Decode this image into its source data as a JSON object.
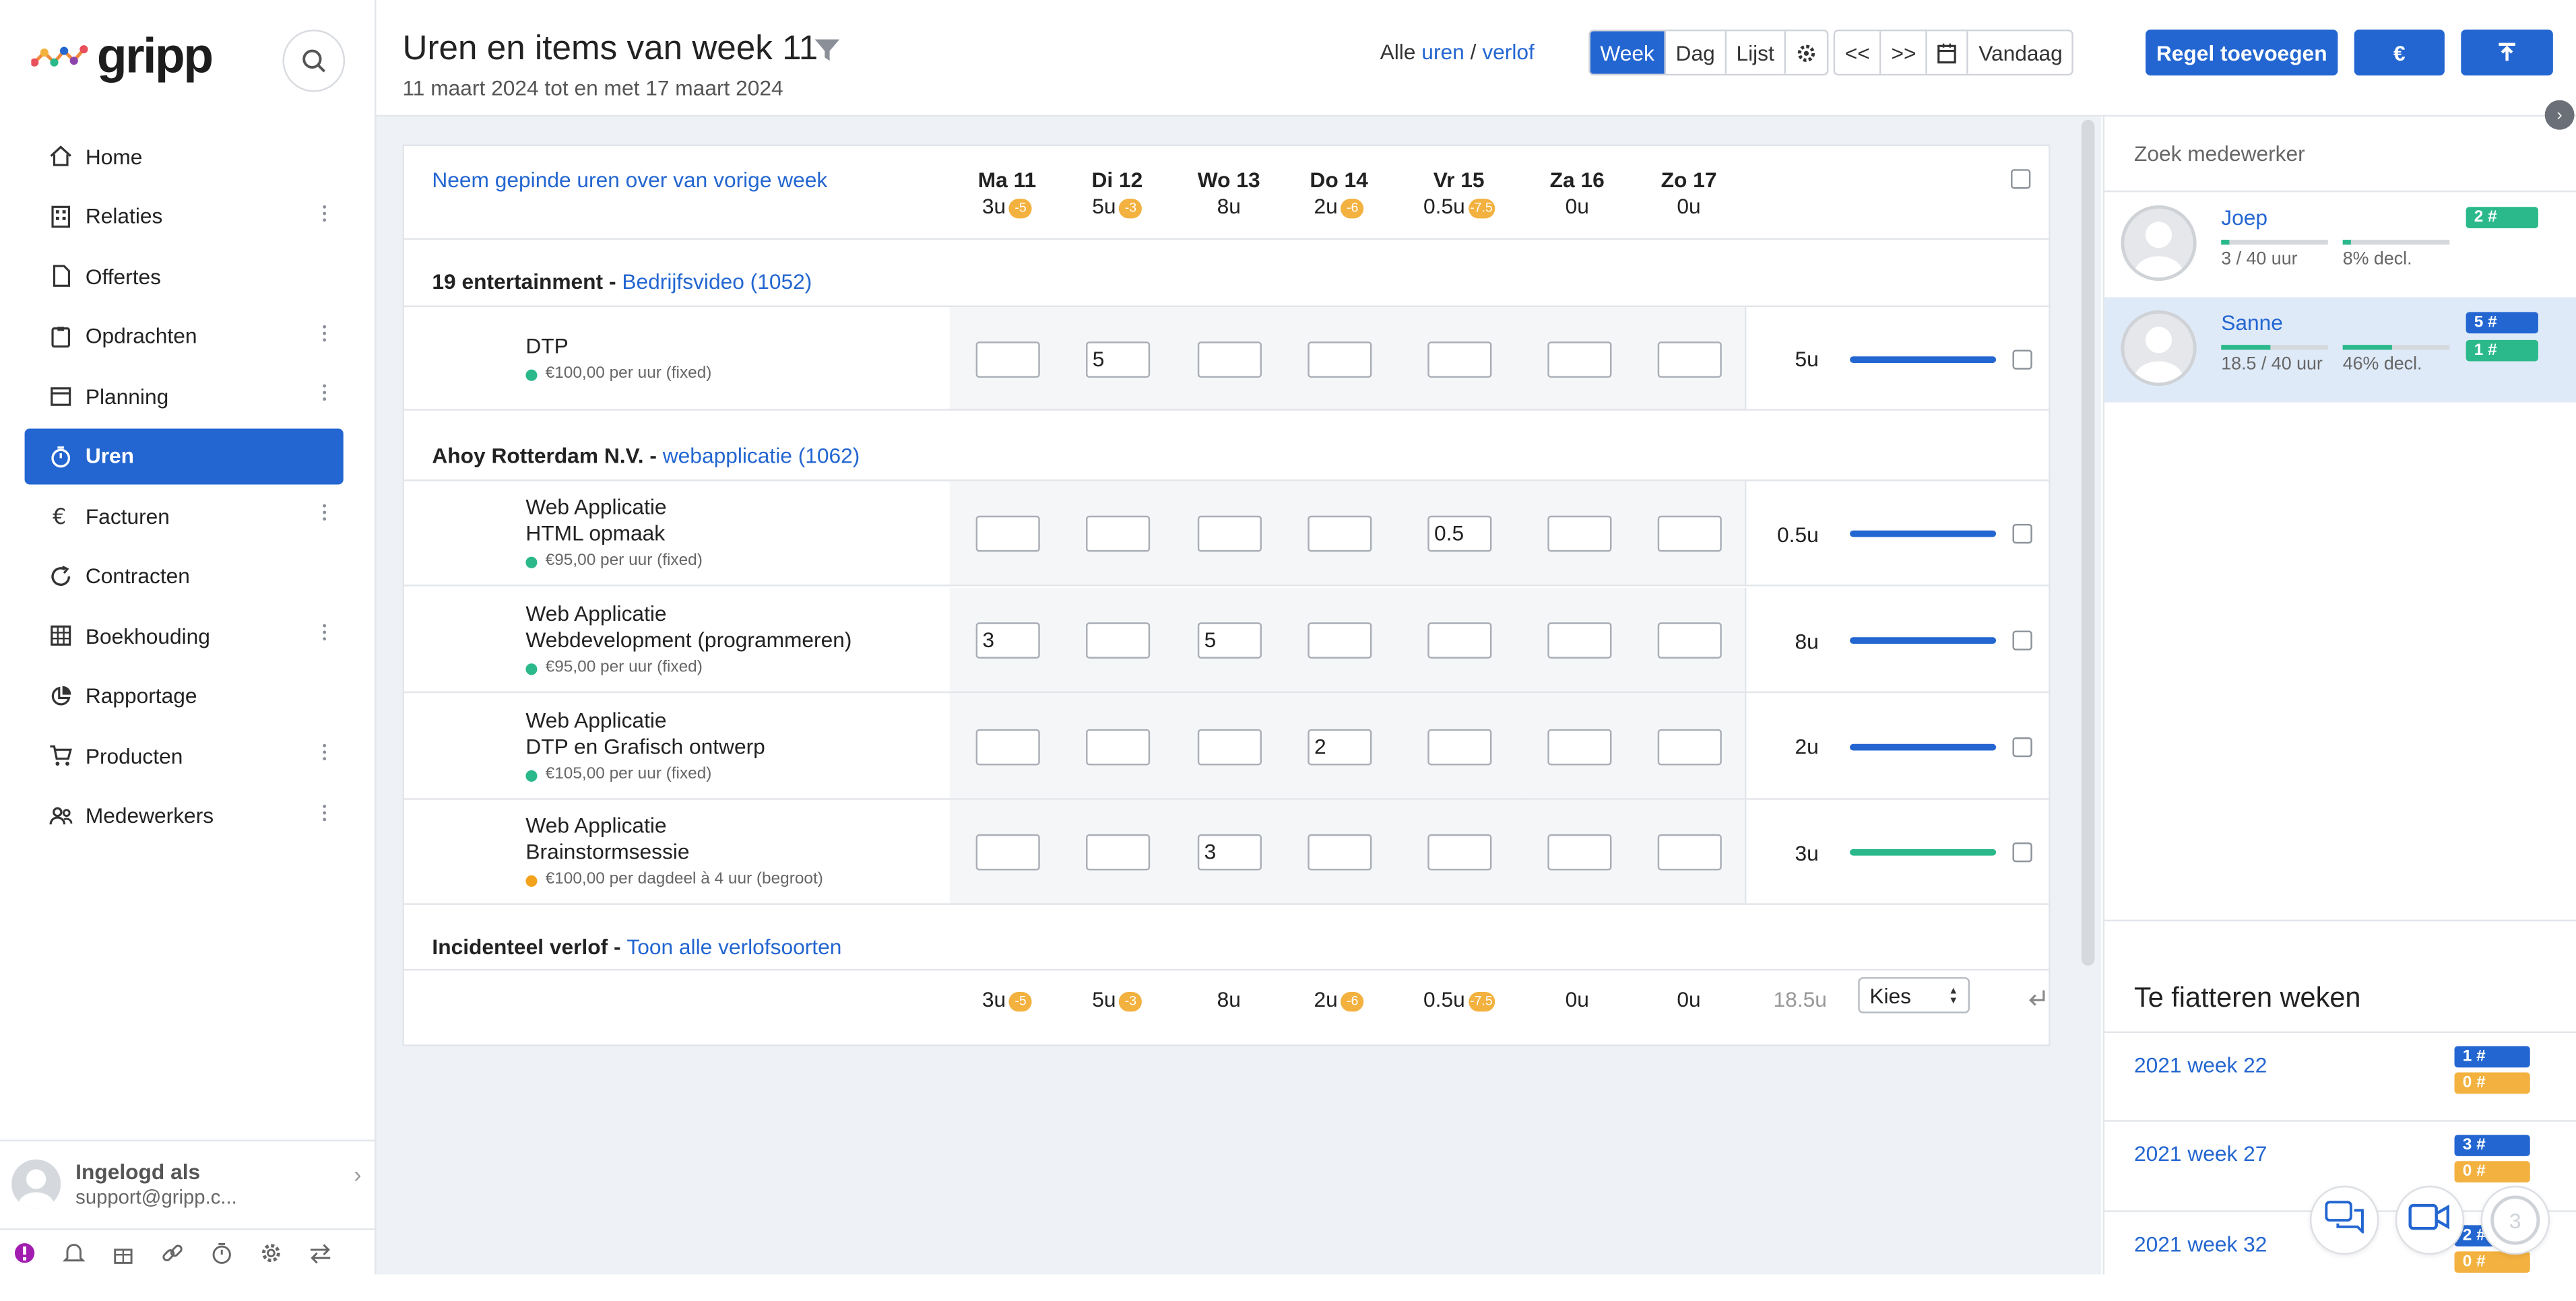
{
  "brand": {
    "name": "gripp"
  },
  "sidebar": {
    "items": [
      {
        "label": "Home",
        "icon": "home-icon",
        "has_menu": false
      },
      {
        "label": "Relaties",
        "icon": "building-icon",
        "has_menu": true
      },
      {
        "label": "Offertes",
        "icon": "document-icon",
        "has_menu": false
      },
      {
        "label": "Opdrachten",
        "icon": "clipboard-icon",
        "has_menu": true
      },
      {
        "label": "Planning",
        "icon": "calendar-icon",
        "has_menu": true
      },
      {
        "label": "Uren",
        "icon": "stopwatch-icon",
        "has_menu": false,
        "active": true
      },
      {
        "label": "Facturen",
        "icon": "euro-icon",
        "has_menu": true
      },
      {
        "label": "Contracten",
        "icon": "refresh-icon",
        "has_menu": false
      },
      {
        "label": "Boekhouding",
        "icon": "grid-icon",
        "has_menu": true
      },
      {
        "label": "Rapportage",
        "icon": "pie-chart-icon",
        "has_menu": false
      },
      {
        "label": "Producten",
        "icon": "cart-icon",
        "has_menu": true
      },
      {
        "label": "Medewerkers",
        "icon": "users-icon",
        "has_menu": true
      }
    ],
    "user": {
      "line1": "Ingelogd als",
      "line2": "support@gripp.c..."
    },
    "bottom_icons": [
      "alert-icon",
      "bell-icon",
      "gift-icon",
      "link-icon",
      "timer-icon",
      "gear-icon",
      "switch-icon"
    ]
  },
  "header": {
    "title": "Uren en items van week 11",
    "subtitle": "11 maart 2024 tot en met 17 maart 2024",
    "filter": {
      "prefix": "Alle",
      "uren": "uren",
      "sep": "/",
      "verlof": "verlof"
    },
    "views": [
      "Week",
      "Dag",
      "Lijst"
    ],
    "active_view": "Week",
    "nav": {
      "prev": "<<",
      "next": ">>",
      "today": "Vandaag"
    },
    "add_button": "Regel toevoegen",
    "euro_button": "€",
    "export_icon": "upload-icon"
  },
  "grid": {
    "pinned_link": "Neem gepinde uren over van vorige week",
    "days": [
      {
        "name": "Ma 11",
        "value": "3u",
        "badge": "-5"
      },
      {
        "name": "Di 12",
        "value": "5u",
        "badge": "-3"
      },
      {
        "name": "Wo 13",
        "value": "8u",
        "badge": ""
      },
      {
        "name": "Do 14",
        "value": "2u",
        "badge": "-6"
      },
      {
        "name": "Vr 15",
        "value": "0.5u",
        "badge": "-7.5"
      },
      {
        "name": "Za 16",
        "value": "0u",
        "badge": ""
      },
      {
        "name": "Zo 17",
        "value": "0u",
        "badge": ""
      }
    ],
    "groups": [
      {
        "client": "19 entertainment",
        "dash": " - ",
        "project": "Bedrijfsvideo (1052)",
        "rows": [
          {
            "line1": "DTP",
            "line2": "",
            "rate": "€100,00 per uur (fixed)",
            "dot": "#2bb98b",
            "cells": [
              "",
              "5",
              "",
              "",
              "",
              "",
              ""
            ],
            "total": "5u",
            "bar_color": "#2366d1"
          }
        ]
      },
      {
        "client": "Ahoy Rotterdam N.V.",
        "dash": " - ",
        "project": "webapplicatie (1062)",
        "rows": [
          {
            "line1": "Web Applicatie",
            "line2": "HTML opmaak",
            "rate": "€95,00 per uur (fixed)",
            "dot": "#2bb98b",
            "cells": [
              "",
              "",
              "",
              "",
              "0.5",
              "",
              ""
            ],
            "total": "0.5u",
            "bar_color": "#2366d1"
          },
          {
            "line1": "Web Applicatie",
            "line2": "Webdevelopment (programmeren)",
            "rate": "€95,00 per uur (fixed)",
            "dot": "#2bb98b",
            "cells": [
              "3",
              "",
              "5",
              "",
              "",
              "",
              ""
            ],
            "total": "8u",
            "bar_color": "#2366d1"
          },
          {
            "line1": "Web Applicatie",
            "line2": "DTP en Grafisch ontwerp",
            "rate": "€105,00 per uur (fixed)",
            "dot": "#2bb98b",
            "cells": [
              "",
              "",
              "",
              "2",
              "",
              "",
              ""
            ],
            "total": "2u",
            "bar_color": "#2366d1"
          },
          {
            "line1": "Web Applicatie",
            "line2": "Brainstormsessie",
            "rate": "€100,00 per dagdeel à 4 uur (begroot)",
            "dot": "#f3a21c",
            "cells": [
              "",
              "",
              "3",
              "",
              "",
              "",
              ""
            ],
            "total": "3u",
            "bar_color": "#2bb98b"
          }
        ]
      }
    ],
    "verlof": {
      "title": "Incidenteel verlof",
      "dash": " - ",
      "link": "Toon alle verlofsoorten"
    },
    "footer": {
      "values": [
        {
          "value": "3u",
          "badge": "-5"
        },
        {
          "value": "5u",
          "badge": "-3"
        },
        {
          "value": "8u",
          "badge": ""
        },
        {
          "value": "2u",
          "badge": "-6"
        },
        {
          "value": "0.5u",
          "badge": "-7.5"
        },
        {
          "value": "0u",
          "badge": ""
        },
        {
          "value": "0u",
          "badge": ""
        }
      ],
      "total": "18.5u",
      "select": "Kies"
    }
  },
  "right_panel": {
    "search_placeholder": "Zoek medewerker",
    "employees": [
      {
        "name": "Joep",
        "hours": "3 / 40 uur",
        "decl": "8% decl.",
        "hours_fraction": 0.075,
        "decl_fraction": 0.08,
        "badges": [
          {
            "text": "2 #",
            "color": "#2bb98b"
          }
        ],
        "selected": false
      },
      {
        "name": "Sanne",
        "hours": "18.5 / 40 uur",
        "decl": "46% decl.",
        "hours_fraction": 0.46,
        "decl_fraction": 0.46,
        "badges": [
          {
            "text": "5 #",
            "color": "#2366d1"
          },
          {
            "text": "1 #",
            "color": "#2bb98b"
          }
        ],
        "selected": true
      }
    ],
    "fiat_title": "Te fiatteren weken",
    "fiat_weeks": [
      {
        "label": "2021 week 22",
        "badges": [
          {
            "text": "1 #",
            "color": "#2366d1"
          },
          {
            "text": "0 #",
            "color": "#f3b13f"
          }
        ]
      },
      {
        "label": "2021 week 27",
        "badges": [
          {
            "text": "3 #",
            "color": "#2366d1"
          },
          {
            "text": "0 #",
            "color": "#f3b13f"
          }
        ]
      },
      {
        "label": "2021 week 32",
        "badges": [
          {
            "text": "2 #",
            "color": "#2366d1"
          },
          {
            "text": "0 #",
            "color": "#f3b13f"
          }
        ]
      }
    ],
    "fab_icons": [
      "chat-icon",
      "video-icon",
      "help-icon"
    ],
    "fab_help_count": "3"
  }
}
